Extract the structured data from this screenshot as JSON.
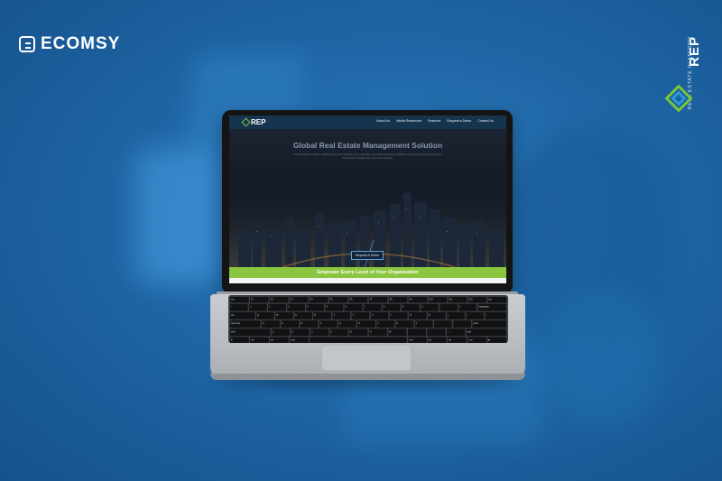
{
  "brand": {
    "name": "ECOMSY",
    "icon": "ecomsy-logo-icon"
  },
  "rep_logo": {
    "name": "REP",
    "subtitle": "REAL ESTATE PLATFORM"
  },
  "site": {
    "logo": "REP",
    "nav": [
      "About Us",
      "Media Resources",
      "Features",
      "Request a Demo",
      "Contact Us"
    ],
    "hero_title": "Global Real Estate Management Solution",
    "hero_text": "The Real Estate Platform (REP) by Ecomsy Software is an enterprise real estate technology platform empowering companies around the world to manage and grow their business.",
    "hero_button": "Request A Demo",
    "banner": "Empower Every Level of Your Organization"
  },
  "keyboard": {
    "rows": [
      [
        "esc",
        "F1",
        "F2",
        "F3",
        "F4",
        "F5",
        "F6",
        "F7",
        "F8",
        "F9",
        "F10",
        "F11",
        "F12",
        "del"
      ],
      [
        "~",
        "1",
        "2",
        "3",
        "4",
        "5",
        "6",
        "7",
        "8",
        "9",
        "0",
        "-",
        "=",
        "backspace"
      ],
      [
        "tab",
        "Q",
        "W",
        "E",
        "R",
        "T",
        "Y",
        "U",
        "I",
        "O",
        "P",
        "[",
        "]",
        "\\"
      ],
      [
        "caps lock",
        "A",
        "S",
        "D",
        "F",
        "G",
        "H",
        "J",
        "K",
        "L",
        ";",
        "'",
        "enter"
      ],
      [
        "shift",
        "Z",
        "X",
        "C",
        "V",
        "B",
        "N",
        "M",
        ",",
        ".",
        "/",
        "shift"
      ],
      [
        "fn",
        "ctrl",
        "alt",
        "cmd",
        "",
        "cmd",
        "alt",
        "◀",
        "▲▼",
        "▶"
      ]
    ]
  },
  "colors": {
    "background": "#1f66a6",
    "accent_green": "#8ac63f",
    "nav_bg": "#17344f"
  }
}
